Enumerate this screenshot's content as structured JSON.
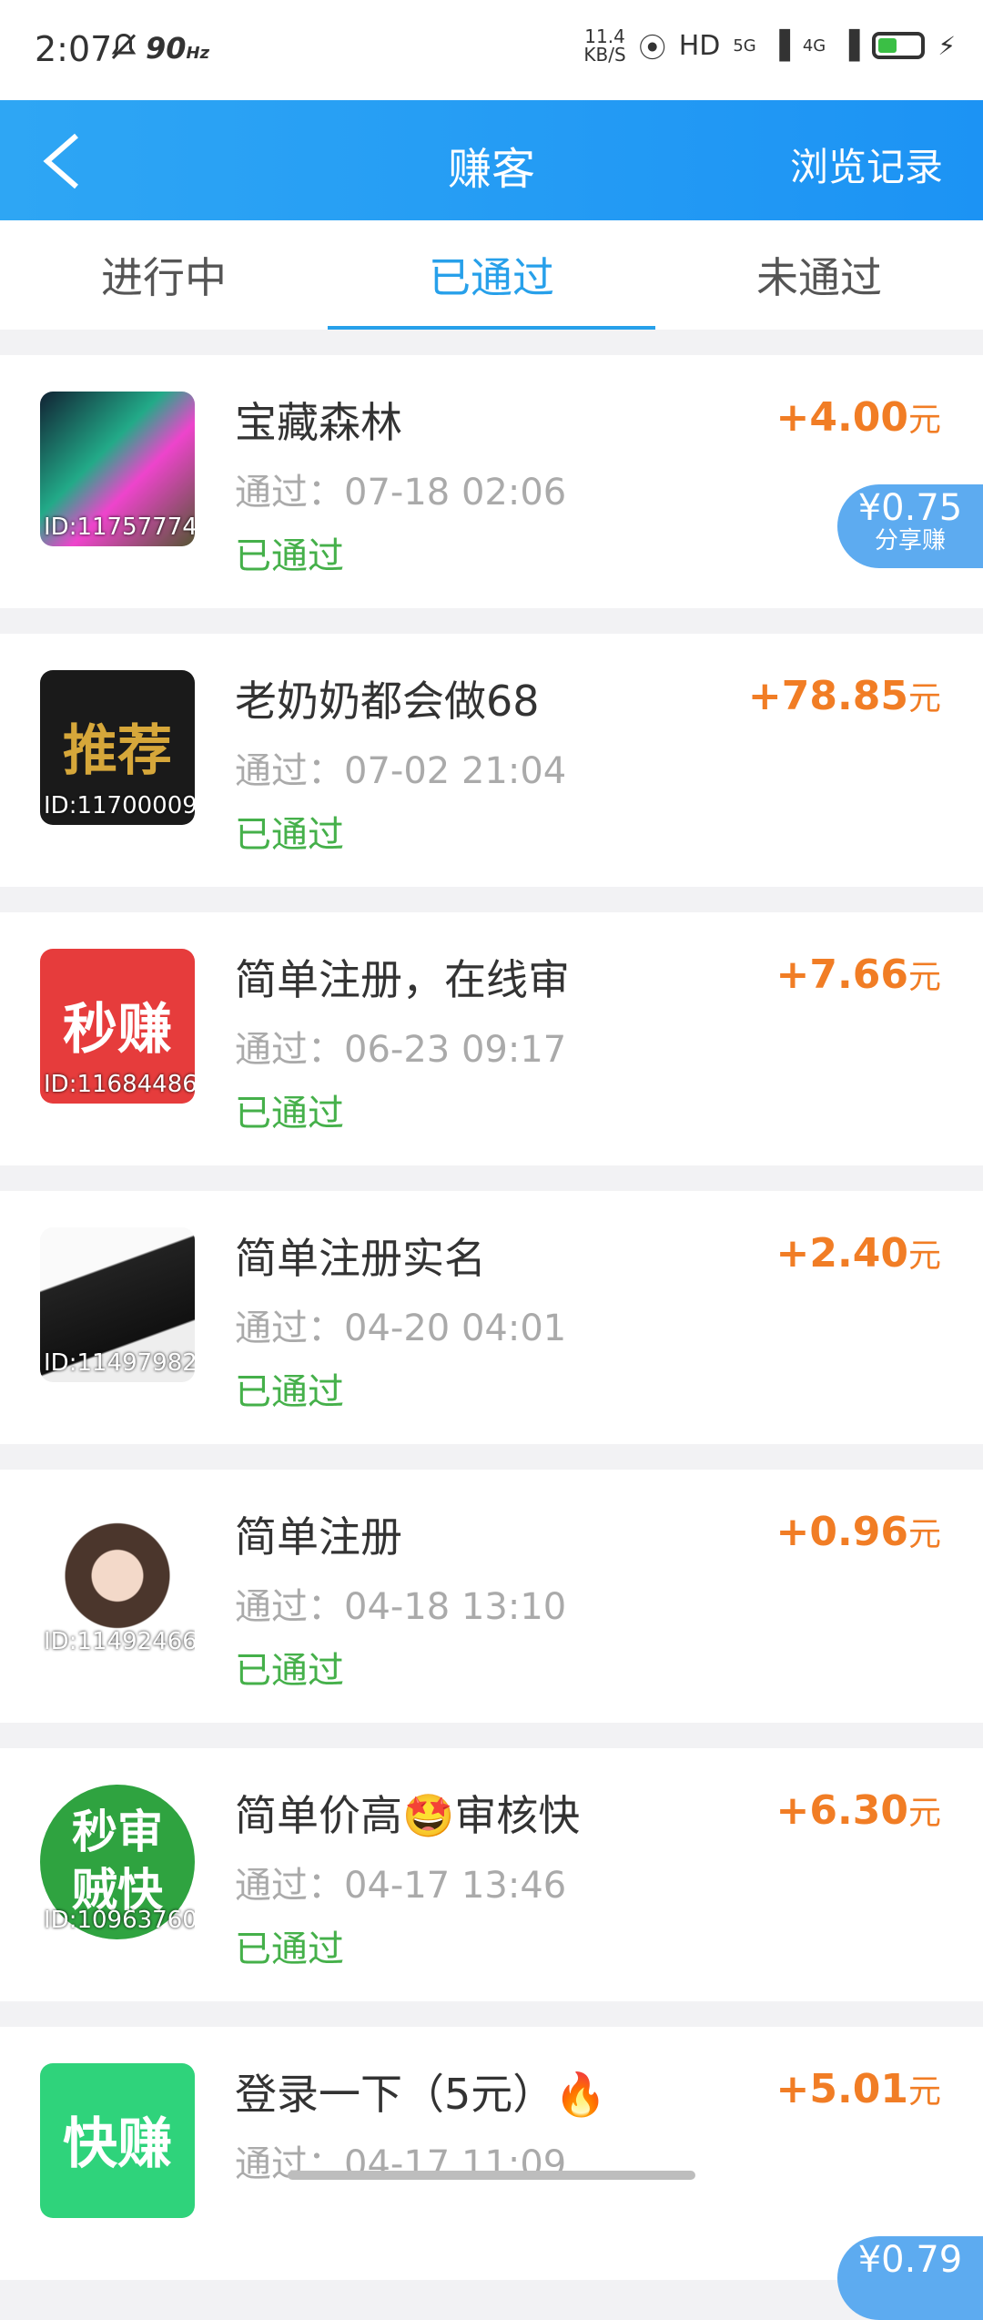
{
  "status_bar": {
    "time": "2:07",
    "refresh": "90",
    "refresh_unit": "Hz",
    "speed_value": "11.4",
    "speed_unit": "KB/S",
    "hd": "HD",
    "net1": "5G",
    "net2": "4G"
  },
  "header": {
    "title": "赚客",
    "history_label": "浏览记录"
  },
  "tabs": [
    {
      "label": "进行中",
      "active": false
    },
    {
      "label": "已通过",
      "active": true
    },
    {
      "label": "未通过",
      "active": false
    }
  ],
  "items": [
    {
      "name": "宝藏森林",
      "time": "通过：07-18 02:06",
      "status": "已通过",
      "amount_prefix": "+",
      "amount": "4.00",
      "unit": "元",
      "id": "ID:11757774",
      "thumb_color": "#2b5a2a",
      "share_value": "¥0.75",
      "share_label": "分享赚"
    },
    {
      "name": "老奶奶都会做68",
      "time": "通过：07-02 21:04",
      "status": "已通过",
      "amount_prefix": "+",
      "amount": "78.85",
      "unit": "元",
      "id": "ID:11700009",
      "thumb_color": "#1a1a1a",
      "thumb_text": "推荐"
    },
    {
      "name": "简单注册，在线审",
      "time": "通过：06-23 09:17",
      "status": "已通过",
      "amount_prefix": "+",
      "amount": "7.66",
      "unit": "元",
      "id": "ID:11684486",
      "thumb_color": "#e63c3c",
      "thumb_text": "秒赚"
    },
    {
      "name": "简单注册实名",
      "time": "通过：04-20 04:01",
      "status": "已通过",
      "amount_prefix": "+",
      "amount": "2.40",
      "unit": "元",
      "id": "ID:11497982",
      "thumb_color": "#d8d8d8"
    },
    {
      "name": "简单注册",
      "time": "通过：04-18 13:10",
      "status": "已通过",
      "amount_prefix": "+",
      "amount": "0.96",
      "unit": "元",
      "id": "ID:11492466",
      "thumb_color": "#e8d9cf"
    },
    {
      "name": "简单价高🤩审核快",
      "time": "通过：04-17 13:46",
      "status": "已通过",
      "amount_prefix": "+",
      "amount": "6.30",
      "unit": "元",
      "id": "ID:10963760",
      "thumb_color": "#2fa340",
      "thumb_text": "秒审贼快"
    },
    {
      "name": "登录一下（5元）🔥",
      "time": "通过：04-17 11:09",
      "status": "",
      "amount_prefix": "+",
      "amount": "5.01",
      "unit": "元",
      "id": "",
      "thumb_color": "#2fd37b",
      "thumb_text": "快赚",
      "share_value": "¥0.79",
      "share_label": ""
    }
  ]
}
